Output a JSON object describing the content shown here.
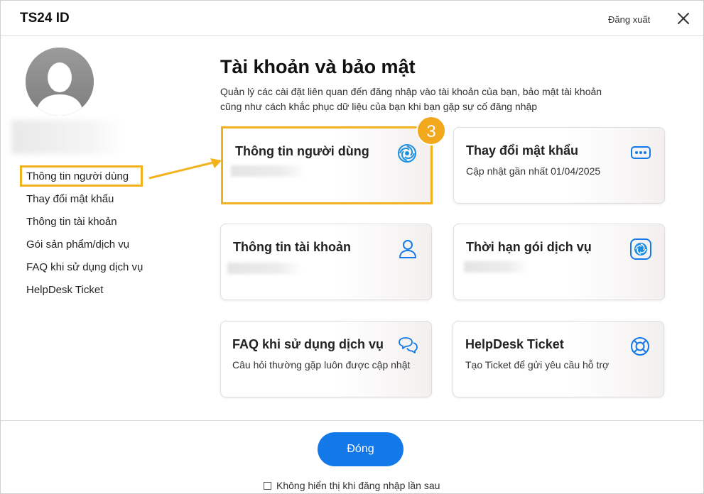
{
  "header": {
    "app_title": "TS24 ID",
    "logout_label": "Đăng xuất"
  },
  "sidebar": {
    "items": [
      {
        "label": "Thông tin người dùng",
        "active": true
      },
      {
        "label": "Thay đổi mật khẩu"
      },
      {
        "label": "Thông tin tài khoản"
      },
      {
        "label": "Gói sản phẩm/dịch vụ"
      },
      {
        "label": "FAQ khi sử dụng dịch vụ"
      },
      {
        "label": "HelpDesk Ticket"
      }
    ]
  },
  "main": {
    "title": "Tài khoản và bảo mật",
    "description": "Quản lý các cài đặt liên quan đến đăng nhập vào tài khoản của bạn, bảo mật tài khoản cũng như cách khắc phục dữ liệu của bạn khi bạn gặp sự cố đăng nhập",
    "step_badge": "3",
    "cards": [
      {
        "title": "Thông tin người dùng",
        "subtitle": "",
        "icon": "swirl-logo-icon"
      },
      {
        "title": "Thay đổi mật khẩu",
        "subtitle": "Cập nhật gần nhất 01/04/2025",
        "icon": "password-dots-icon"
      },
      {
        "title": "Thông tin tài khoản",
        "subtitle": "",
        "icon": "user-icon"
      },
      {
        "title": "Thời hạn gói dịch vụ",
        "subtitle": "",
        "icon": "service-logo-icon"
      },
      {
        "title": "FAQ khi sử dụng dịch vụ",
        "subtitle": "Câu hỏi thường gặp luôn được cập nhật",
        "icon": "chat-bubbles-icon"
      },
      {
        "title": "HelpDesk Ticket",
        "subtitle": "Tạo Ticket để gửi yêu cầu hỗ trợ",
        "icon": "lifebuoy-icon"
      }
    ]
  },
  "footer": {
    "close_label": "Đóng",
    "dont_show_label": "Không hiển thị khi đăng nhập lần sau"
  },
  "colors": {
    "accent": "#1479e8",
    "highlight": "#f2b21b",
    "badge": "#f2a81d"
  }
}
